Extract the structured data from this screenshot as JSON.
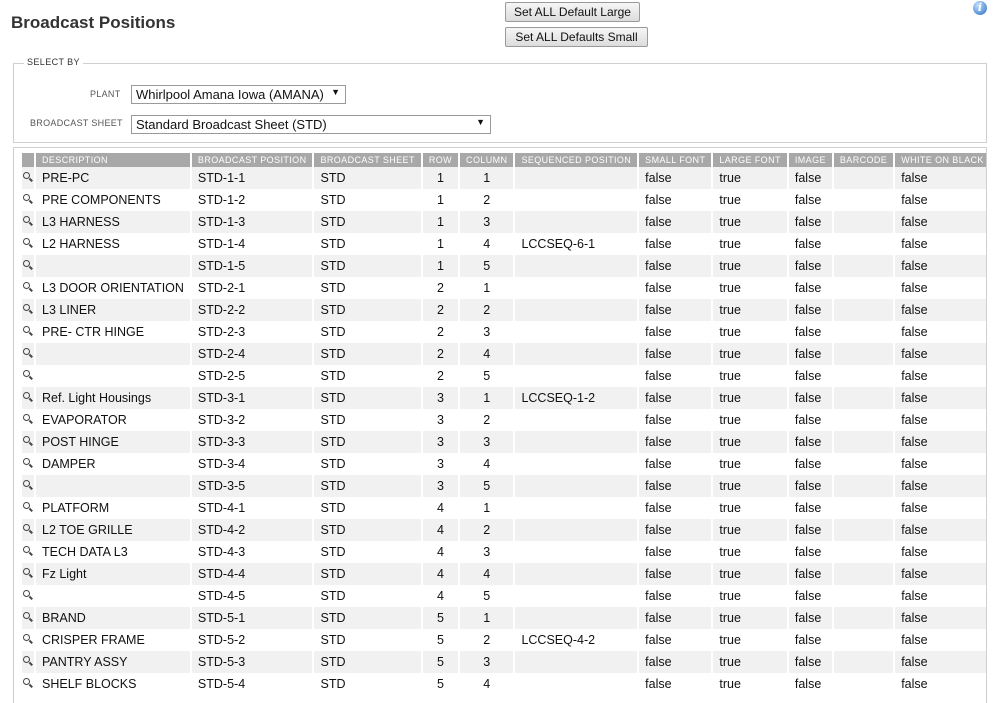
{
  "page": {
    "title": "Broadcast Positions"
  },
  "toolbar": {
    "set_large_label": "Set ALL Default Large",
    "set_small_label": "Set ALL Defaults Small"
  },
  "filters": {
    "legend": "SELECT BY",
    "plant_label": "PLANT",
    "plant_value": "Whirlpool Amana Iowa (AMANA)",
    "sheet_label": "BROADCAST SHEET",
    "sheet_value": "Standard Broadcast Sheet (STD)"
  },
  "table": {
    "columns": [
      "",
      "DESCRIPTION",
      "BROADCAST POSITION",
      "BROADCAST SHEET",
      "ROW",
      "COLUMN",
      "SEQUENCED POSITION",
      "SMALL FONT",
      "LARGE FONT",
      "IMAGE",
      "BARCODE",
      "WHITE ON BLACK"
    ],
    "rows": [
      {
        "description": "PRE-PC",
        "position": "STD-1-1",
        "sheet": "STD",
        "row": "1",
        "column": "1",
        "sequenced": "",
        "small_font": "false",
        "large_font": "true",
        "image": "false",
        "barcode": "",
        "white_on_black": "false"
      },
      {
        "description": "PRE COMPONENTS",
        "position": "STD-1-2",
        "sheet": "STD",
        "row": "1",
        "column": "2",
        "sequenced": "",
        "small_font": "false",
        "large_font": "true",
        "image": "false",
        "barcode": "",
        "white_on_black": "false"
      },
      {
        "description": "L3 HARNESS",
        "position": "STD-1-3",
        "sheet": "STD",
        "row": "1",
        "column": "3",
        "sequenced": "",
        "small_font": "false",
        "large_font": "true",
        "image": "false",
        "barcode": "",
        "white_on_black": "false"
      },
      {
        "description": "L2 HARNESS",
        "position": "STD-1-4",
        "sheet": "STD",
        "row": "1",
        "column": "4",
        "sequenced": "LCCSEQ-6-1",
        "small_font": "false",
        "large_font": "true",
        "image": "false",
        "barcode": "",
        "white_on_black": "false"
      },
      {
        "description": "",
        "position": "STD-1-5",
        "sheet": "STD",
        "row": "1",
        "column": "5",
        "sequenced": "",
        "small_font": "false",
        "large_font": "true",
        "image": "false",
        "barcode": "",
        "white_on_black": "false"
      },
      {
        "description": "L3 DOOR ORIENTATION",
        "position": "STD-2-1",
        "sheet": "STD",
        "row": "2",
        "column": "1",
        "sequenced": "",
        "small_font": "false",
        "large_font": "true",
        "image": "false",
        "barcode": "",
        "white_on_black": "false"
      },
      {
        "description": "L3 LINER",
        "position": "STD-2-2",
        "sheet": "STD",
        "row": "2",
        "column": "2",
        "sequenced": "",
        "small_font": "false",
        "large_font": "true",
        "image": "false",
        "barcode": "",
        "white_on_black": "false"
      },
      {
        "description": "PRE- CTR HINGE",
        "position": "STD-2-3",
        "sheet": "STD",
        "row": "2",
        "column": "3",
        "sequenced": "",
        "small_font": "false",
        "large_font": "true",
        "image": "false",
        "barcode": "",
        "white_on_black": "false"
      },
      {
        "description": "",
        "position": "STD-2-4",
        "sheet": "STD",
        "row": "2",
        "column": "4",
        "sequenced": "",
        "small_font": "false",
        "large_font": "true",
        "image": "false",
        "barcode": "",
        "white_on_black": "false"
      },
      {
        "description": "",
        "position": "STD-2-5",
        "sheet": "STD",
        "row": "2",
        "column": "5",
        "sequenced": "",
        "small_font": "false",
        "large_font": "true",
        "image": "false",
        "barcode": "",
        "white_on_black": "false"
      },
      {
        "description": "Ref. Light Housings",
        "position": "STD-3-1",
        "sheet": "STD",
        "row": "3",
        "column": "1",
        "sequenced": "LCCSEQ-1-2",
        "small_font": "false",
        "large_font": "true",
        "image": "false",
        "barcode": "",
        "white_on_black": "false"
      },
      {
        "description": "EVAPORATOR",
        "position": "STD-3-2",
        "sheet": "STD",
        "row": "3",
        "column": "2",
        "sequenced": "",
        "small_font": "false",
        "large_font": "true",
        "image": "false",
        "barcode": "",
        "white_on_black": "false"
      },
      {
        "description": "POST HINGE",
        "position": "STD-3-3",
        "sheet": "STD",
        "row": "3",
        "column": "3",
        "sequenced": "",
        "small_font": "false",
        "large_font": "true",
        "image": "false",
        "barcode": "",
        "white_on_black": "false"
      },
      {
        "description": "DAMPER",
        "position": "STD-3-4",
        "sheet": "STD",
        "row": "3",
        "column": "4",
        "sequenced": "",
        "small_font": "false",
        "large_font": "true",
        "image": "false",
        "barcode": "",
        "white_on_black": "false"
      },
      {
        "description": "",
        "position": "STD-3-5",
        "sheet": "STD",
        "row": "3",
        "column": "5",
        "sequenced": "",
        "small_font": "false",
        "large_font": "true",
        "image": "false",
        "barcode": "",
        "white_on_black": "false"
      },
      {
        "description": "PLATFORM",
        "position": "STD-4-1",
        "sheet": "STD",
        "row": "4",
        "column": "1",
        "sequenced": "",
        "small_font": "false",
        "large_font": "true",
        "image": "false",
        "barcode": "",
        "white_on_black": "false"
      },
      {
        "description": "L2 TOE GRILLE",
        "position": "STD-4-2",
        "sheet": "STD",
        "row": "4",
        "column": "2",
        "sequenced": "",
        "small_font": "false",
        "large_font": "true",
        "image": "false",
        "barcode": "",
        "white_on_black": "false"
      },
      {
        "description": "TECH DATA L3",
        "position": "STD-4-3",
        "sheet": "STD",
        "row": "4",
        "column": "3",
        "sequenced": "",
        "small_font": "false",
        "large_font": "true",
        "image": "false",
        "barcode": "",
        "white_on_black": "false"
      },
      {
        "description": "Fz Light",
        "position": "STD-4-4",
        "sheet": "STD",
        "row": "4",
        "column": "4",
        "sequenced": "",
        "small_font": "false",
        "large_font": "true",
        "image": "false",
        "barcode": "",
        "white_on_black": "false"
      },
      {
        "description": "",
        "position": "STD-4-5",
        "sheet": "STD",
        "row": "4",
        "column": "5",
        "sequenced": "",
        "small_font": "false",
        "large_font": "true",
        "image": "false",
        "barcode": "",
        "white_on_black": "false"
      },
      {
        "description": "BRAND",
        "position": "STD-5-1",
        "sheet": "STD",
        "row": "5",
        "column": "1",
        "sequenced": "",
        "small_font": "false",
        "large_font": "true",
        "image": "false",
        "barcode": "",
        "white_on_black": "false"
      },
      {
        "description": "CRISPER FRAME",
        "position": "STD-5-2",
        "sheet": "STD",
        "row": "5",
        "column": "2",
        "sequenced": "LCCSEQ-4-2",
        "small_font": "false",
        "large_font": "true",
        "image": "false",
        "barcode": "",
        "white_on_black": "false"
      },
      {
        "description": "PANTRY ASSY",
        "position": "STD-5-3",
        "sheet": "STD",
        "row": "5",
        "column": "3",
        "sequenced": "",
        "small_font": "false",
        "large_font": "true",
        "image": "false",
        "barcode": "",
        "white_on_black": "false"
      },
      {
        "description": "SHELF BLOCKS",
        "position": "STD-5-4",
        "sheet": "STD",
        "row": "5",
        "column": "4",
        "sequenced": "",
        "small_font": "false",
        "large_font": "true",
        "image": "false",
        "barcode": "",
        "white_on_black": "false"
      }
    ]
  }
}
